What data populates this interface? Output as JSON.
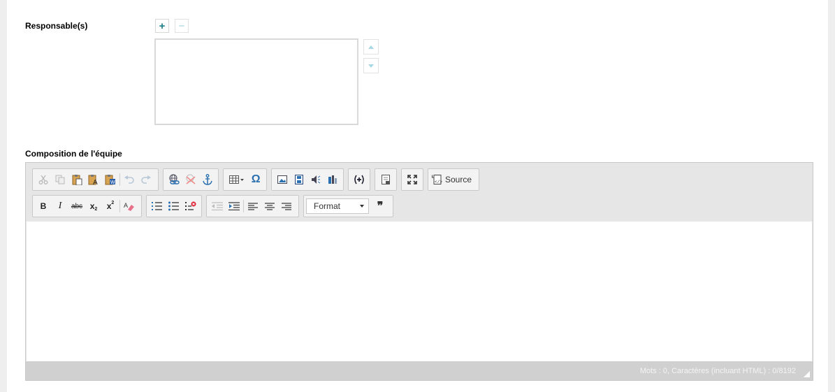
{
  "responsables": {
    "label": "Responsable(s)",
    "add_symbol": "+",
    "remove_symbol": "−"
  },
  "composition": {
    "label": "Composition de l'équipe"
  },
  "editor": {
    "toolbar_row1": [
      {
        "name": "cut-button",
        "icon": "scissors-icon",
        "enabled": false
      },
      {
        "name": "copy-button",
        "icon": "copy-icon",
        "enabled": false
      },
      {
        "name": "paste-button",
        "icon": "clipboard-icon",
        "enabled": true
      },
      {
        "name": "paste-text-button",
        "icon": "clipboard-text-icon",
        "enabled": true
      },
      {
        "name": "paste-word-button",
        "icon": "clipboard-word-icon",
        "enabled": true
      },
      {
        "name": "undo-button",
        "icon": "undo-icon",
        "enabled": false
      },
      {
        "name": "redo-button",
        "icon": "redo-icon",
        "enabled": false
      },
      {
        "name": "link-button",
        "icon": "link-icon",
        "enabled": true
      },
      {
        "name": "unlink-button",
        "icon": "unlink-icon",
        "enabled": false
      },
      {
        "name": "anchor-button",
        "icon": "anchor-icon",
        "enabled": true
      },
      {
        "name": "table-button",
        "icon": "table-icon",
        "enabled": true
      },
      {
        "name": "special-char-button",
        "icon": "omega-icon",
        "enabled": true
      },
      {
        "name": "image-button",
        "icon": "image-icon",
        "enabled": true
      },
      {
        "name": "video-button",
        "icon": "film-icon",
        "enabled": true
      },
      {
        "name": "audio-button",
        "icon": "speaker-icon",
        "enabled": true
      },
      {
        "name": "flash-button",
        "icon": "book-icon",
        "enabled": true
      },
      {
        "name": "placeholder-button",
        "icon": "plus-circle-icon",
        "enabled": true
      },
      {
        "name": "templates-button",
        "icon": "page-icon",
        "enabled": true
      },
      {
        "name": "maximize-button",
        "icon": "expand-icon",
        "enabled": true
      }
    ],
    "source_label": "Source",
    "omega": "Ω",
    "bold": "B",
    "italic": "I",
    "strike": "abc",
    "subscript_base": "x",
    "subscript_mark": "2",
    "superscript_base": "x",
    "superscript_mark": "2",
    "format_label": "Format",
    "quote_symbol": "❞",
    "status_text": "Mots : 0, Caractères (incluant HTML) : 0/8192"
  },
  "colors": {
    "accent_teal": "#2aa0a8",
    "icon_blue": "#2a6fb0",
    "disabled": "#b8b8b8",
    "status_bar": "#d0d0d0"
  }
}
